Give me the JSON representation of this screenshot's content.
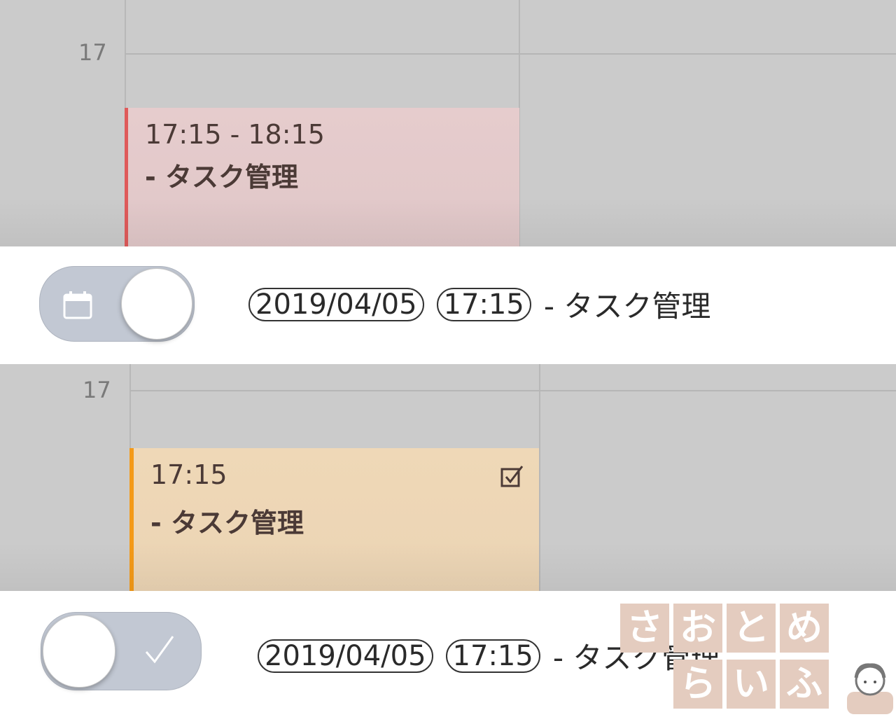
{
  "calendar_top": {
    "hour_label": "17",
    "event": {
      "time": "17:15 - 18:15",
      "title": "- タスク管理",
      "accent_color": "#df5a5a"
    }
  },
  "bar_top": {
    "toggle": {
      "state": "on",
      "icon": "calendar-icon"
    },
    "date": "2019/04/05",
    "time": "17:15",
    "task": "- タスク管理"
  },
  "calendar_bottom": {
    "hour_label": "17",
    "event": {
      "time": "17:15",
      "title": "- タスク管理",
      "accent_color": "#f49a18",
      "icon": "checkbox-checked-icon"
    }
  },
  "bar_bottom": {
    "toggle": {
      "state": "off",
      "icon": "checkmark-icon"
    },
    "date": "2019/04/05",
    "time": "17:15",
    "task": "- タスク管理"
  },
  "watermark": {
    "chars": [
      "さ",
      "お",
      "と",
      "め",
      "ら",
      "い",
      "ふ"
    ],
    "color": "#e4ccbf"
  }
}
